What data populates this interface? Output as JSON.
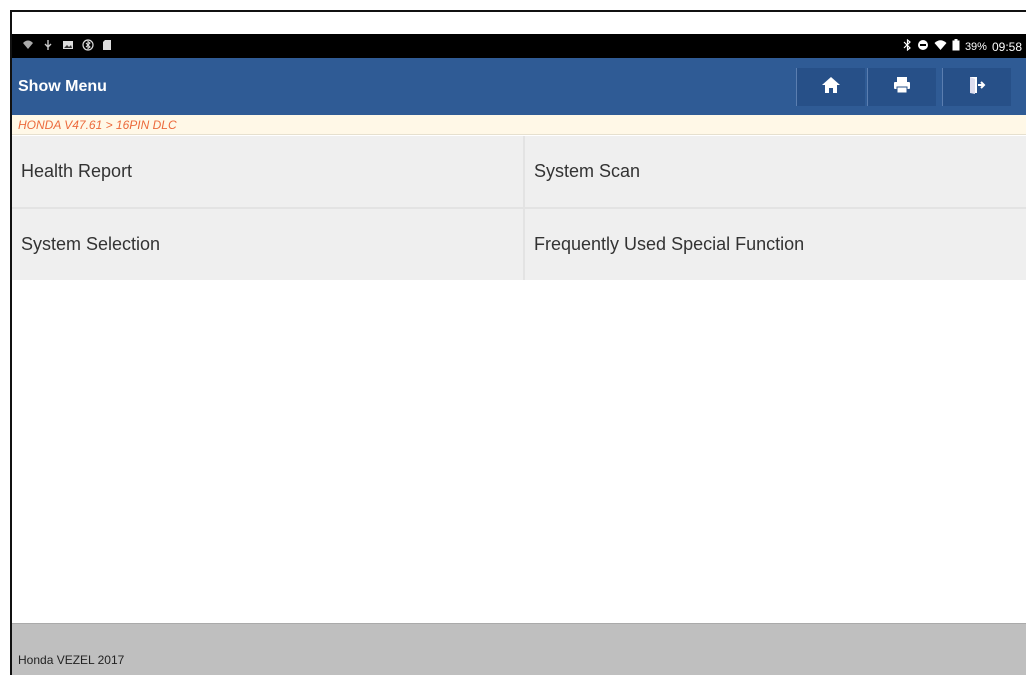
{
  "status_bar": {
    "left_icons": [
      "wifi-icon",
      "usb-icon",
      "image-icon",
      "bluetooth-icon",
      "sd-card-icon"
    ],
    "right_icons": [
      "bluetooth-icon",
      "do-not-disturb-icon",
      "wifi-icon",
      "battery-icon"
    ],
    "battery": "39%",
    "time": "09:58"
  },
  "header": {
    "title": "Show Menu",
    "buttons": [
      "home-icon",
      "print-icon",
      "exit-icon"
    ]
  },
  "breadcrumb": "HONDA V47.61 > 16PIN DLC",
  "menu": {
    "items": [
      {
        "label": "Health Report"
      },
      {
        "label": "System Scan"
      },
      {
        "label": "System Selection"
      },
      {
        "label": "Frequently Used Special Function"
      }
    ]
  },
  "footer": {
    "vehicle": "Honda VEZEL 2017"
  },
  "colors": {
    "title_bar": "#2f5b95",
    "breadcrumb_text": "#ec6a3c",
    "menu_bg": "#efefef",
    "footer_bg": "#bfbfbf"
  }
}
